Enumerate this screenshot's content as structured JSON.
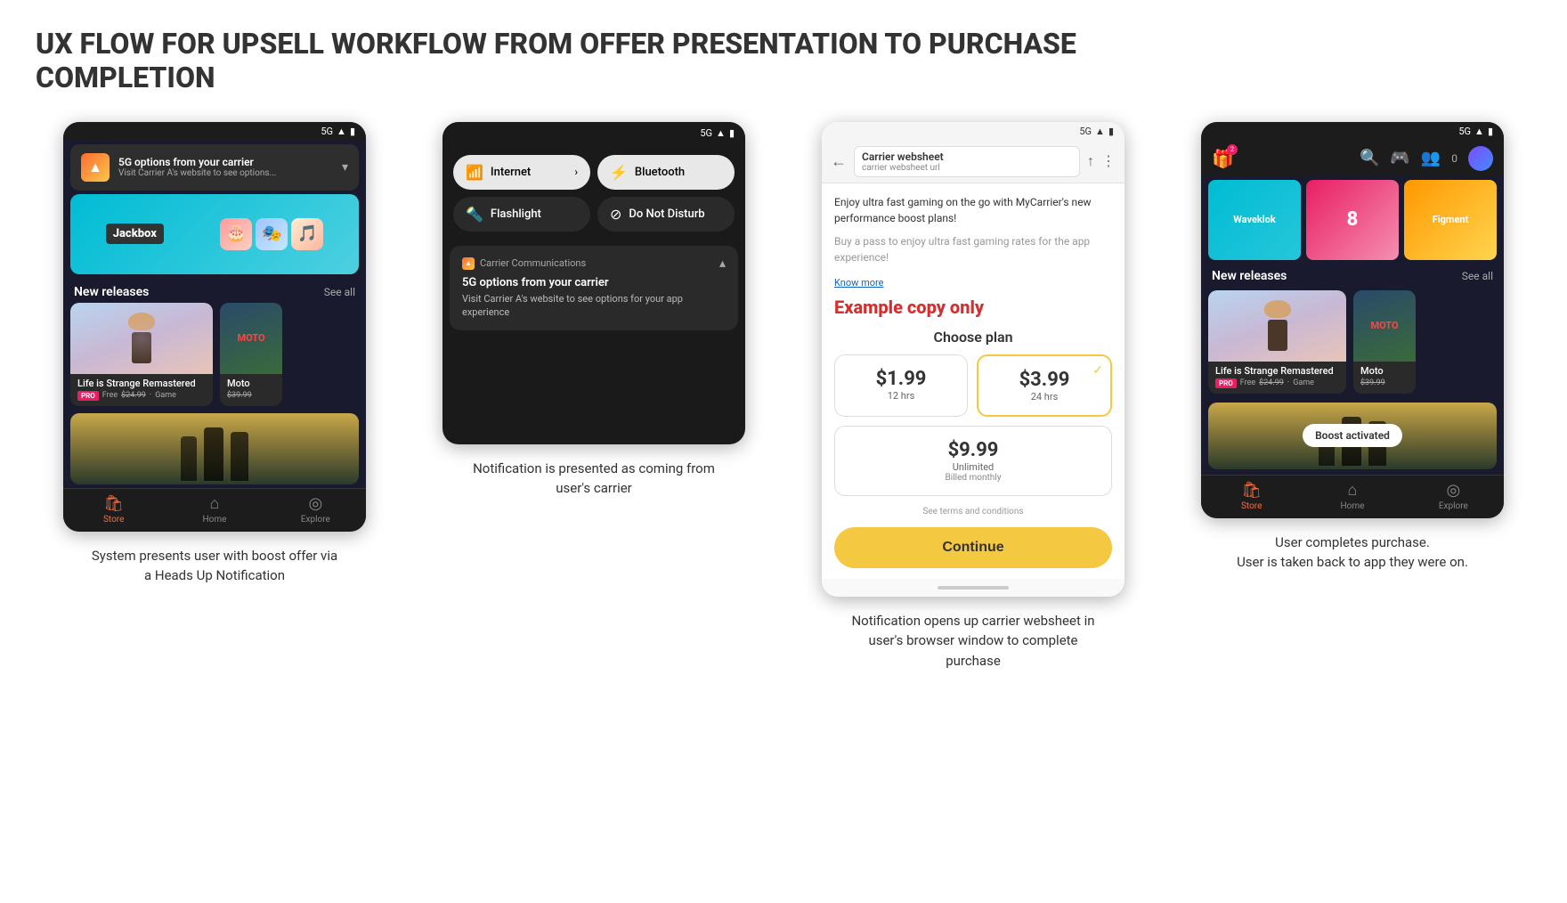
{
  "page": {
    "title_line1": "UX FLOW FOR UPSELL WORKFLOW FROM OFFER PRESENTATION TO PURCHASE",
    "title_line2": "COMPLETION"
  },
  "screen1": {
    "status_bar": "5G",
    "hun_title": "5G options from your carrier",
    "hun_subtitle": "Visit Carrier A's website to see options...",
    "jackbox_label": "Jackbox",
    "section_title": "New releases",
    "see_all": "See all",
    "game1_title": "Life is Strange Remastered",
    "game1_pro": "PRO",
    "game1_free": "Free",
    "game1_price": "$24.99",
    "game1_type": "Game",
    "game2_title": "Moto",
    "game2_price": "$39.99",
    "nav_store": "Store",
    "nav_home": "Home",
    "nav_explore": "Explore",
    "caption": "System presents user with boost offer via a Heads Up Notification"
  },
  "screen2": {
    "status_bar": "5G",
    "qs_internet": "Internet",
    "qs_bluetooth": "Bluetooth",
    "qs_flashlight": "Flashlight",
    "qs_dnd": "Do Not Disturb",
    "notif_app": "Carrier Communications",
    "notif_title": "5G options from your carrier",
    "notif_body": "Visit Carrier A's website to see options for your app experience",
    "caption": "Notification is presented as coming from user's carrier"
  },
  "screen3": {
    "status_bar": "5G",
    "browser_title": "Carrier websheet",
    "browser_url": "carrier websheet url",
    "promo_text": "Enjoy ultra fast gaming on the go with MyCarrier's new performance boost plans!",
    "promo_sub": "Buy a pass to enjoy ultra fast gaming rates for the app experience!",
    "know_more": "Know more",
    "example_label": "Example copy only",
    "choose_plan": "Choose plan",
    "plan1_price": "$1.99",
    "plan1_duration": "12 hrs",
    "plan2_price": "$3.99",
    "plan2_duration": "24 hrs",
    "plan3_price": "$9.99",
    "plan3_label": "Unlimited",
    "plan3_billed": "Billed monthly",
    "terms": "See terms and conditions",
    "continue_btn": "Continue",
    "caption": "Notification opens up carrier websheet in user's browser window to complete purchase"
  },
  "screen4": {
    "status_bar": "5G",
    "gift_badge": "2",
    "section_title": "New releases",
    "see_all": "See all",
    "game1_title": "Life is Strange Remastered",
    "game1_pro": "PRO",
    "game1_free": "Free",
    "game1_price": "$24.99",
    "game1_type": "Game",
    "game2_title": "Moto",
    "game2_price": "$39.99",
    "boost_activated": "Boost activated",
    "nav_store": "Store",
    "nav_home": "Home",
    "nav_explore": "Explore",
    "caption_line1": "User completes purchase.",
    "caption_line2": "User is taken back to app they were on."
  },
  "icons": {
    "wifi": "📶",
    "battery": "🔋",
    "signal_bars": "▋▋▋",
    "chevron_down": "▾",
    "chevron_up": "▴",
    "back_arrow": "←",
    "share": "↑",
    "more_vert": "⋮",
    "store": "🛍",
    "home": "⌂",
    "explore": "🔍",
    "search": "🔍",
    "gamepad": "🎮",
    "people": "👥",
    "check": "✓",
    "bluetooth": "⚡",
    "flashlight": "🔦",
    "dnd": "⊘",
    "internet": "📶"
  }
}
